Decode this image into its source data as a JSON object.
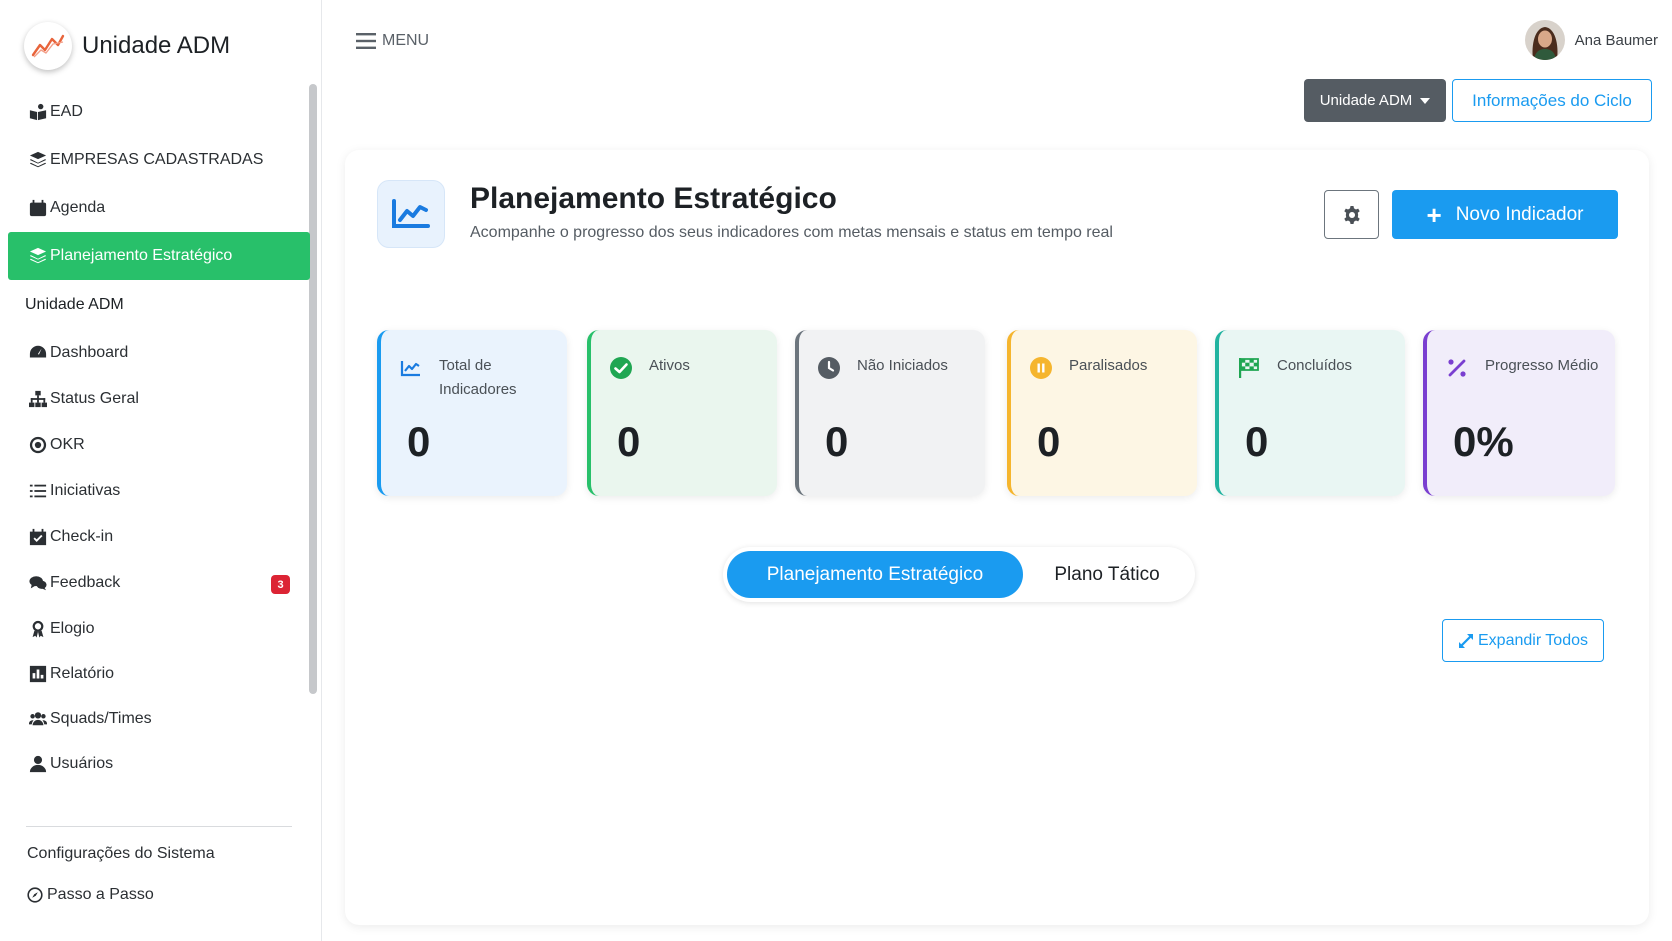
{
  "brand": {
    "title": "Unidade ADM"
  },
  "sidebar": {
    "items": [
      {
        "label": "EAD",
        "icon": "book-reader-icon"
      },
      {
        "label": "EMPRESAS CADASTRADAS",
        "icon": "layers-icon"
      },
      {
        "label": "Agenda",
        "icon": "calendar-icon"
      },
      {
        "label": "Planejamento Estratégico",
        "icon": "layers-icon",
        "active": true
      }
    ],
    "section": "Unidade ADM",
    "section_items": [
      {
        "label": "Dashboard",
        "icon": "gauge-icon"
      },
      {
        "label": "Status Geral",
        "icon": "sitemap-icon"
      },
      {
        "label": "OKR",
        "icon": "target-icon"
      },
      {
        "label": "Iniciativas",
        "icon": "list-icon"
      },
      {
        "label": "Check-in",
        "icon": "calendar-check-icon"
      },
      {
        "label": "Feedback",
        "icon": "comments-icon",
        "badge": "3"
      },
      {
        "label": "Elogio",
        "icon": "award-icon"
      },
      {
        "label": "Relatório",
        "icon": "chart-square-icon"
      },
      {
        "label": "Squads/Times",
        "icon": "users-icon"
      },
      {
        "label": "Usuários",
        "icon": "user-icon"
      }
    ],
    "config": "Configurações do Sistema",
    "passo": "Passo a Passo"
  },
  "topbar": {
    "menu_label": "MENU",
    "user_name": "Ana Baumer",
    "unit_select": "Unidade ADM",
    "cycle_button": "Informações do Ciclo"
  },
  "header": {
    "title": "Planejamento Estratégico",
    "subtitle": "Acompanhe o progresso dos seus indicadores com metas mensais e status em tempo real",
    "new_button": "Novo Indicador"
  },
  "stats": [
    {
      "label": "Total de Indicadores",
      "value": "0",
      "color": "#1a9bf0",
      "bg": "#eaf3fd",
      "icon": "chart-line-icon"
    },
    {
      "label": "Ativos",
      "value": "0",
      "color": "#28c06a",
      "bg": "#eaf6ee",
      "icon": "check-circle-icon"
    },
    {
      "label": "Não Iniciados",
      "value": "0",
      "color": "#6c757d",
      "bg": "#f1f2f3",
      "icon": "clock-icon"
    },
    {
      "label": "Paralisados",
      "value": "0",
      "color": "#f5b52e",
      "bg": "#fdf6e4",
      "icon": "pause-circle-icon"
    },
    {
      "label": "Concluídos",
      "value": "0",
      "color": "#22b3a0",
      "bg": "#e9f6f3",
      "icon": "flag-checkered-icon"
    },
    {
      "label": "Progresso Médio",
      "value": "0%",
      "color": "#7a3fd0",
      "bg": "#f1edfa",
      "icon": "percent-icon"
    }
  ],
  "tabs": {
    "active": "Planejamento Estratégico",
    "other": "Plano Tático"
  },
  "expand_button": "Expandir Todos"
}
